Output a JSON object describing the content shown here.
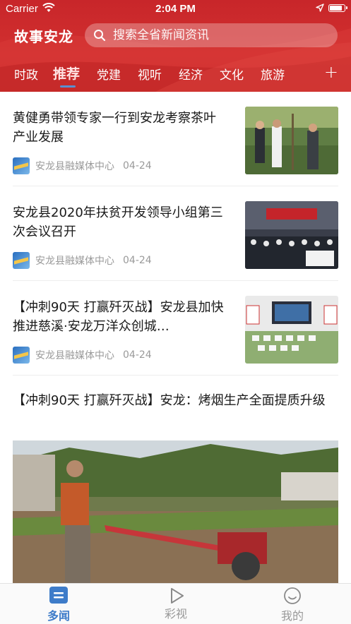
{
  "status_bar": {
    "carrier": "Carrier",
    "time": "2:04 PM"
  },
  "header": {
    "brand": "故事安龙",
    "search_placeholder": "搜索全省新闻资讯",
    "tabs": [
      "时政",
      "推荐",
      "党建",
      "视听",
      "经济",
      "文化",
      "旅游"
    ],
    "active_tab": "推荐",
    "add_label": "+"
  },
  "news": [
    {
      "title": "黄健勇带领专家一行到安龙考察茶叶产业发展",
      "source": "安龙县融媒体中心",
      "date": "04-24"
    },
    {
      "title": "安龙县2020年扶贫开发领导小组第三次会议召开",
      "source": "安龙县融媒体中心",
      "date": "04-24"
    },
    {
      "title": "【冲刺90天 打赢歼灭战】安龙县加快推进慈溪·安龙万洋众创城…",
      "source": "安龙县融媒体中心",
      "date": "04-24"
    },
    {
      "title": "【冲刺90天 打赢歼灭战】安龙：烤烟生产全面提质升级"
    }
  ],
  "bottom_nav": [
    {
      "label": "多闻",
      "icon": "news-icon",
      "active": true
    },
    {
      "label": "彩视",
      "icon": "play-icon",
      "active": false
    },
    {
      "label": "我的",
      "icon": "profile-icon",
      "active": false
    }
  ],
  "colors": {
    "header_red": "#c8262a",
    "accent_blue": "#3e7cc9"
  }
}
